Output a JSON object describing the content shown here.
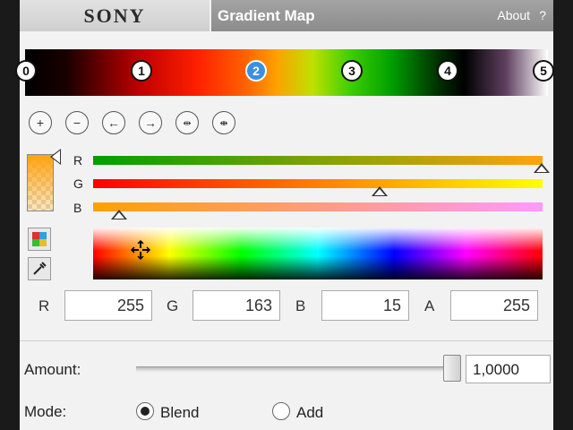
{
  "header": {
    "brand": "SONY",
    "title": "Gradient Map",
    "about": "About",
    "help": "?"
  },
  "gradient": {
    "stops": [
      "0",
      "1",
      "2",
      "3",
      "4",
      "5"
    ],
    "selected_stop": "2"
  },
  "toolbar": {
    "add_icon": "plus-circle-icon",
    "remove_icon": "minus-circle-icon",
    "move_left_icon": "arrow-left-circle-icon",
    "move_right_icon": "arrow-right-circle-icon",
    "spread_icon": "spread-stops-icon",
    "gather_icon": "gather-stops-icon"
  },
  "color": {
    "channels": [
      {
        "label": "R",
        "value": 255,
        "level": 1.0
      },
      {
        "label": "G",
        "value": 163,
        "level": 0.64
      },
      {
        "label": "B",
        "value": 15,
        "level": 0.06
      }
    ],
    "fields": [
      {
        "label": "R",
        "value": "255"
      },
      {
        "label": "G",
        "value": "163"
      },
      {
        "label": "B",
        "value": "15"
      },
      {
        "label": "A",
        "value": "255"
      }
    ],
    "swatch_hex": "#FFA30F"
  },
  "amount": {
    "label": "Amount:",
    "value": "1,0000",
    "level": 1.0
  },
  "mode": {
    "label": "Mode:",
    "options": [
      "Blend",
      "Add"
    ],
    "selected": "Blend"
  }
}
